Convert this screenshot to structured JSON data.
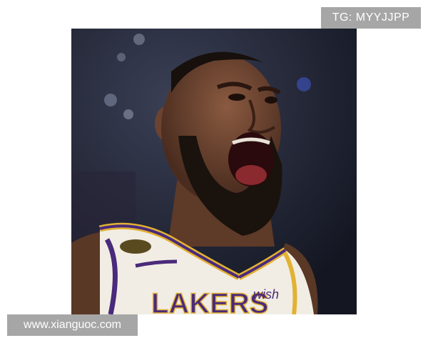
{
  "watermark_top": "TG: MYYJJPP",
  "watermark_bottom": "www.xianguoc.com",
  "photo": {
    "subject": "basketball-player-shouting",
    "jersey_text": "LAKERS",
    "sponsor_text": "wish",
    "colors": {
      "background": "#1e2231",
      "skin": "#6b4330",
      "beard": "#1a120d",
      "jersey": "#f1ede4",
      "trim_purple": "#4a2a7a",
      "trim_gold": "#e2b233"
    }
  }
}
